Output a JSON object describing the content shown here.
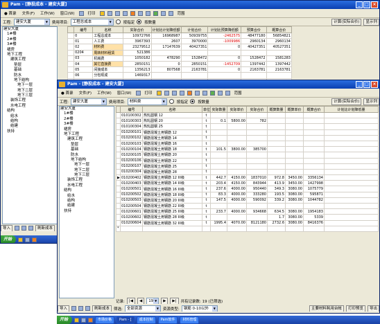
{
  "back_window": {
    "title": "Pam - [静投成本 - 建安大厦]",
    "menu": [
      "● 首录",
      "文件(F)",
      "工作(W)",
      "窗口(W)",
      "打印",
      "校验"
    ],
    "search_label": "范围",
    "project_label": "工程:",
    "project_value": "建安大厦",
    "filter_label": "费用项目:",
    "filter_value": "工程总成本",
    "radio_a": "按指定",
    "radio_b": "按数量",
    "calc_button": "计算(实际合价)",
    "show_button": "显示列",
    "tree": [
      "建安大厦",
      "1#楼",
      "2#楼",
      "3#楼",
      "裙房",
      "地下工程",
      "建筑工程",
      "垫层",
      "基础",
      "防水",
      "地下结构",
      "地下一层",
      "地下二层",
      "地下三层",
      "装饰工程",
      "水电工程",
      "结构",
      "给水",
      "结构",
      "结建",
      "扶持"
    ],
    "columns": [
      "编号",
      "名称",
      "实际合价",
      "计划比计划降低额",
      "计划合价",
      "计划比预算降低额",
      "预算合价",
      "概算合价"
    ],
    "rows": [
      {
        "no": "0",
        "name": "工程总成本",
        "v": [
          "10972766",
          "16968987",
          "50939755",
          "-2462575",
          "48477180",
          "56854821"
        ],
        "hl": false,
        "neg": true
      },
      {
        "no": "01",
        "name": "人工费",
        "v": [
          "3967393",
          "2607",
          "3970000",
          "-1009986",
          "2960134",
          "2960134"
        ],
        "hl": false,
        "neg": true
      },
      {
        "no": "02",
        "name": "材料费",
        "v": [
          "23279512",
          "17147639",
          "40427351",
          "0",
          "40427351",
          "40527351"
        ],
        "hl": true,
        "neg": false
      },
      {
        "no": "0204",
        "name": "周转材料租赁",
        "v": [
          "521386",
          "",
          "",
          "",
          "",
          ""
        ],
        "hl": true,
        "neg": false
      },
      {
        "no": "03",
        "name": "机械费",
        "v": [
          "1050182",
          "478290",
          "1528472",
          "0",
          "1528472",
          "1581283"
        ],
        "hl": false,
        "neg": false
      },
      {
        "no": "04",
        "name": "其它直接费",
        "v": [
          "2850151",
          "0",
          "2850151",
          "-1452709",
          "1397442",
          "1397442"
        ],
        "hl": true,
        "neg": true
      },
      {
        "no": "05",
        "name": "间接成本",
        "v": [
          "1356213",
          "807568",
          "2163781",
          "0",
          "2163781",
          "2163781"
        ],
        "hl": false,
        "neg": false
      },
      {
        "no": "06",
        "name": "分包现成",
        "v": [
          "1469317",
          "",
          "",
          "",
          "",
          ""
        ],
        "hl": false,
        "neg": false
      }
    ],
    "status_buttons": [
      "导入",
      "刷新成本"
    ],
    "taskbar_start": "开始"
  },
  "front_window": {
    "title": "Pam - [静投成本 - 建安大厦]",
    "menu": [
      "● 首录",
      "文件(F)",
      "工作(W)",
      "窗口(W)",
      "打印",
      "校验"
    ],
    "search_label": "范围",
    "project_label": "工程:",
    "project_value": "建安大厦",
    "filter_label": "费用项目:",
    "filter_value": "材料费",
    "radio_a": "按指定",
    "radio_b": "按数量",
    "calc_button": "计算(实际合价)",
    "show_button": "显示列",
    "tree": [
      "建安大厦",
      "1#楼",
      "2#楼",
      "3#楼",
      "裙房",
      "地下工程",
      "建筑工程",
      "垫层",
      "基础",
      "防水",
      "地下结构",
      "地下一层",
      "地下二层",
      "地下三层",
      "装饰工程",
      "水电工程",
      "结构",
      "给水",
      "结构",
      "结建",
      "扶持"
    ],
    "columns": [
      "编号",
      "名称",
      "单位",
      "实际数量",
      "实际单价",
      "实际合价",
      "概算数量",
      "概算单价",
      "概算合价",
      "计划比计划降低量"
    ],
    "rows": [
      {
        "no": "010100302",
        "name": "热轧圆钢 12",
        "unit": "t",
        "v": [
          "",
          "",
          "",
          "",
          "",
          "",
          ""
        ]
      },
      {
        "no": "010100303",
        "name": "热轧圆钢 20",
        "unit": "t",
        "v": [
          "0.1",
          "5800.00",
          "782",
          "",
          "",
          "",
          ""
        ]
      },
      {
        "no": "010100304",
        "name": "热轧圆钢 25",
        "unit": "t",
        "v": [
          "",
          "",
          "",
          "",
          "",
          "",
          ""
        ]
      },
      {
        "no": "010200101",
        "name": "钢筋混凝土用钢筋 12",
        "unit": "t",
        "v": [
          "",
          "",
          "",
          "",
          "",
          "",
          ""
        ]
      },
      {
        "no": "010200102",
        "name": "钢筋混凝土用钢筋 14",
        "unit": "t",
        "v": [
          "",
          "",
          "",
          "",
          "",
          "",
          ""
        ]
      },
      {
        "no": "010200103",
        "name": "钢筋混凝土用钢筋 16",
        "unit": "t",
        "v": [
          "",
          "",
          "",
          "",
          "",
          "",
          ""
        ]
      },
      {
        "no": "010200104",
        "name": "钢筋混凝土用钢筋 18",
        "unit": "t",
        "v": [
          "101.5",
          "3800.00",
          "385700",
          "",
          "",
          "",
          ""
        ]
      },
      {
        "no": "010200105",
        "name": "钢筋混凝土用钢筋 20",
        "unit": "t",
        "v": [
          "",
          "",
          "",
          "",
          "",
          "",
          ""
        ]
      },
      {
        "no": "010200106",
        "name": "钢筋混凝土用钢筋 22",
        "unit": "t",
        "v": [
          "",
          "",
          "",
          "",
          "",
          "",
          ""
        ]
      },
      {
        "no": "010200107",
        "name": "钢筋混凝土用钢筋 25",
        "unit": "t",
        "v": [
          "",
          "",
          "",
          "",
          "",
          "",
          ""
        ]
      },
      {
        "no": "010200304",
        "name": "钢筋混凝土用钢筋 28",
        "unit": "t",
        "v": [
          "",
          "",
          "",
          "",
          "",
          "",
          ""
        ]
      },
      {
        "no": "010200402",
        "name": "钢筋混凝土用钢筋 12 III级",
        "unit": "t",
        "v": [
          "442.7",
          "4150.00",
          "1837010",
          "972.8",
          "3450.00",
          "3356134",
          ""
        ]
      },
      {
        "no": "010200403",
        "name": "钢筋混凝土用钢筋 14 III级",
        "unit": "t",
        "v": [
          "203.4",
          "4150.00",
          "843944",
          "413.9",
          "3450.00",
          "1427998",
          ""
        ]
      },
      {
        "no": "010200501",
        "name": "钢筋混凝土用钢筋 16 III级",
        "unit": "t",
        "v": [
          "237.6",
          "4000.00",
          "950440",
          "349.3",
          "3080.00",
          "1075779",
          ""
        ]
      },
      {
        "no": "010200502",
        "name": "钢筋混凝土用钢筋 18 III级",
        "unit": "t",
        "v": [
          "83.3",
          "4000.00",
          "333280",
          "193.5",
          "3080.00",
          "595871",
          ""
        ]
      },
      {
        "no": "010200503",
        "name": "钢筋混凝土用钢筋 20 III级",
        "unit": "t",
        "v": [
          "147.5",
          "4000.00",
          "590092",
          "339.2",
          "3080.00",
          "1044782",
          ""
        ]
      },
      {
        "no": "010200504",
        "name": "钢筋混凝土用钢筋 22 III级",
        "unit": "t",
        "v": [
          "",
          "",
          "",
          "",
          "",
          "",
          ""
        ]
      },
      {
        "no": "010200601",
        "name": "钢筋混凝土用钢筋 25 III级",
        "unit": "t",
        "v": [
          "233.7",
          "4000.00",
          "934668",
          "634.5",
          "3080.00",
          "1954183",
          ""
        ]
      },
      {
        "no": "010200602",
        "name": "钢筋混凝土用钢筋 28 III级",
        "unit": "t",
        "v": [
          "",
          "",
          "",
          "1.7",
          "3080.00",
          "5339",
          ""
        ]
      },
      {
        "no": "010200604",
        "name": "钢筋混凝土用钢筋 32 III级",
        "unit": "t",
        "v": [
          "1995.4",
          "4070.00",
          "8121180",
          "2732.6",
          "3080.00",
          "8416376",
          ""
        ]
      }
    ],
    "record_label": "记录:",
    "record_value": "19",
    "record_total": "共有记录数: 19 (已筛选)",
    "status_buttons": [
      "导入",
      "刷新成本"
    ],
    "status_filter_label": "筛选:",
    "status_filter_value": "全部资源",
    "status_type_label": "资源类型:",
    "status_type_value": "钢筋 0-10以外",
    "status_right": [
      "主要材料耗用台帐",
      "打印预览",
      "导出"
    ]
  },
  "taskbar": {
    "start_label": "开始",
    "tasks": [
      "市场价格",
      "Pam - [",
      "成本控制",
      "Pam软件",
      "材料管理"
    ],
    "active_index": 1,
    "clock": ""
  }
}
